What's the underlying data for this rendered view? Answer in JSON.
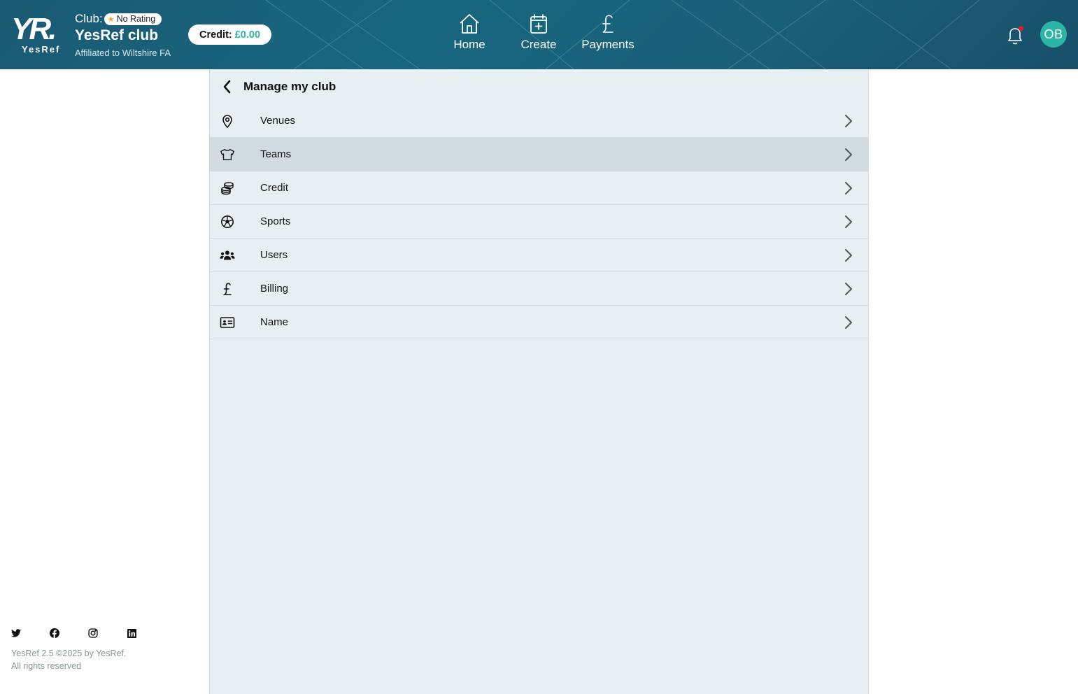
{
  "header": {
    "logo": {
      "mark": "YR",
      "dot": ".",
      "wordmark": "YesRef"
    },
    "club_label": "Club:",
    "rating_badge": "No Rating",
    "club_name": "YesRef club",
    "affiliation": "Affiliated to Wiltshire FA",
    "credit_label": "Credit:",
    "credit_amount": "£0.00",
    "nav": [
      {
        "label": "Home",
        "icon": "home-icon"
      },
      {
        "label": "Create",
        "icon": "calendar-plus-icon"
      },
      {
        "label": "Payments",
        "icon": "pound-icon"
      }
    ],
    "has_notification": true,
    "avatar_initials": "OB"
  },
  "panel": {
    "title": "Manage my club",
    "items": [
      {
        "label": "Venues",
        "icon": "map-pin-icon"
      },
      {
        "label": "Teams",
        "icon": "shirt-icon",
        "active": true
      },
      {
        "label": "Credit",
        "icon": "coins-icon"
      },
      {
        "label": "Sports",
        "icon": "football-icon"
      },
      {
        "label": "Users",
        "icon": "users-icon"
      },
      {
        "label": "Billing",
        "icon": "pound-icon"
      },
      {
        "label": "Name",
        "icon": "id-card-icon"
      }
    ]
  },
  "footer": {
    "socials": [
      "twitter-icon",
      "facebook-icon",
      "instagram-icon",
      "linkedin-icon"
    ],
    "line1": "YesRef 2.5 ©2025 by YesRef.",
    "line2": "All rights reserved"
  },
  "colors": {
    "header_bg": "#17667f",
    "accent": "#2bb5a4",
    "panel_bg": "#e8eff2",
    "active_row": "#d2dbdf"
  }
}
